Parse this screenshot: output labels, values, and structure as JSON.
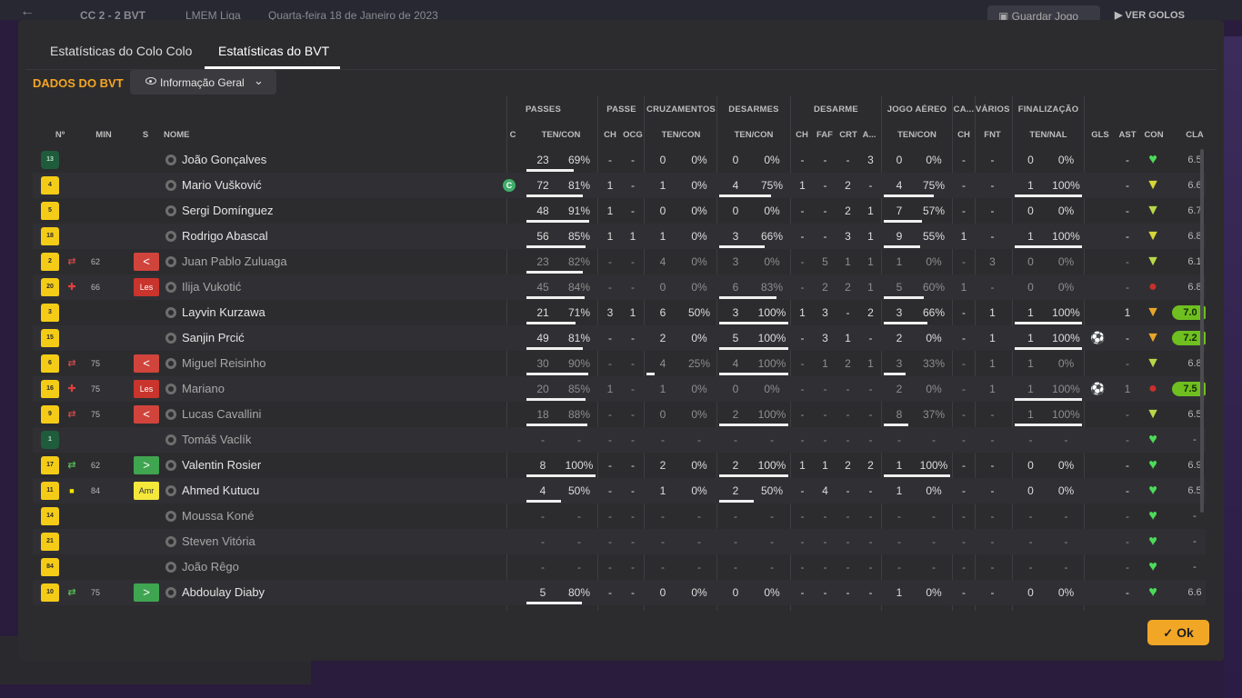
{
  "header": {
    "back_icon": "arrow-left-icon",
    "score": "CC 2 - 2 BVT",
    "competition": "LMEM Liga",
    "date": "Quarta-feira 18 de Janeiro de 2023",
    "save_label": "Guardar Jogo",
    "view_label": "VER GOLOS"
  },
  "tabs": [
    "Estatísticas do Colo Colo",
    "Estatísticas do BVT"
  ],
  "section_title": "DADOS DO BVT",
  "view_select": {
    "label": "Informação Geral",
    "icon": "eye-icon"
  },
  "group_headers": [
    "PASSES",
    "PASSE",
    "CRUZAMENTOS",
    "DESARMES",
    "DESARME",
    "JOGO AÉREO",
    "CA...",
    "VÁRIOS",
    "FINALIZAÇÃO"
  ],
  "columns": [
    "Nº",
    "MIN",
    "S",
    "NOME",
    "C",
    "TEN/CON",
    "CH",
    "OCG",
    "TEN/CON",
    "TEN/CON",
    "CH",
    "FAF",
    "CRT",
    "A...",
    "TEN/CON",
    "CH",
    "FNT",
    "TEN/NAL",
    "GLS",
    "AST",
    "CON",
    "CLA"
  ],
  "colors": {
    "accent": "#f5a623",
    "shirt": "#f4cc17",
    "gk_shirt": "#1f5c3c",
    "rating_high": "#6ebf1f"
  },
  "players": [
    {
      "num": "13",
      "gk": true,
      "name": "João Gonçalves",
      "stats": [
        "23",
        "69%",
        "-",
        "-",
        "0",
        "0%",
        "0",
        "0%",
        "-",
        "-",
        "-",
        "3",
        "0",
        "0%",
        "-",
        "-",
        "0",
        "0%",
        "",
        "-"
      ],
      "con": "green",
      "cla": "6.5",
      "bars": [
        0.69,
        0,
        0,
        0,
        0,
        0
      ]
    },
    {
      "num": "4",
      "name": "Mario Vušković",
      "captain": "C",
      "stats": [
        "72",
        "81%",
        "1",
        "-",
        "1",
        "0%",
        "4",
        "75%",
        "1",
        "-",
        "2",
        "-",
        "4",
        "75%",
        "-",
        "-",
        "1",
        "100%",
        "",
        "-"
      ],
      "con": "yellow",
      "cla": "6.6",
      "bars": [
        0.81,
        0,
        0.75,
        0,
        0.75,
        1
      ]
    },
    {
      "num": "5",
      "name": "Sergi Domínguez",
      "stats": [
        "48",
        "91%",
        "1",
        "-",
        "0",
        "0%",
        "0",
        "0%",
        "-",
        "-",
        "2",
        "1",
        "7",
        "57%",
        "-",
        "-",
        "0",
        "0%",
        "",
        "-"
      ],
      "con": "lime",
      "cla": "6.7",
      "bars": [
        0.91,
        0,
        0,
        0,
        0.57,
        0
      ]
    },
    {
      "num": "18",
      "name": "Rodrigo Abascal",
      "stats": [
        "56",
        "85%",
        "1",
        "1",
        "1",
        "0%",
        "3",
        "66%",
        "-",
        "-",
        "3",
        "1",
        "9",
        "55%",
        "1",
        "-",
        "1",
        "100%",
        "",
        "-"
      ],
      "con": "yellow",
      "cla": "6.8",
      "bars": [
        0.85,
        0,
        0.66,
        0,
        0.55,
        1
      ]
    },
    {
      "num": "2",
      "name": "Juan Pablo Zuluaga",
      "sub": true,
      "event": "sub-out",
      "minute": "62",
      "status": "<",
      "stats": [
        "23",
        "82%",
        "-",
        "-",
        "4",
        "0%",
        "3",
        "0%",
        "-",
        "5",
        "1",
        "1",
        "1",
        "0%",
        "-",
        "3",
        "0",
        "0%",
        "",
        "-"
      ],
      "con": "lime",
      "cla": "6.1",
      "bars": [
        0.82,
        0,
        0,
        0,
        0,
        0
      ]
    },
    {
      "num": "20",
      "name": "Ilija Vukotić",
      "sub": true,
      "event": "injury",
      "minute": "66",
      "status": "Les",
      "stats": [
        "45",
        "84%",
        "-",
        "-",
        "0",
        "0%",
        "6",
        "83%",
        "-",
        "2",
        "2",
        "1",
        "5",
        "60%",
        "1",
        "-",
        "0",
        "0%",
        "",
        "-"
      ],
      "con": "red",
      "cla": "6.8",
      "bars": [
        0.84,
        0,
        0.83,
        0,
        0.6,
        0
      ]
    },
    {
      "num": "3",
      "name": "Layvin Kurzawa",
      "stats": [
        "21",
        "71%",
        "3",
        "1",
        "6",
        "50%",
        "3",
        "100%",
        "1",
        "3",
        "-",
        "2",
        "3",
        "66%",
        "-",
        "1",
        "1",
        "100%",
        "",
        "1"
      ],
      "con": "orange",
      "cla": "7.0",
      "cla_hi": true,
      "bars": [
        0.71,
        0,
        1,
        0,
        0.66,
        1
      ]
    },
    {
      "num": "15",
      "name": "Sanjin Prcić",
      "stats": [
        "49",
        "81%",
        "-",
        "-",
        "2",
        "0%",
        "5",
        "100%",
        "-",
        "3",
        "1",
        "-",
        "2",
        "0%",
        "-",
        "1",
        "1",
        "100%",
        "ball",
        "-"
      ],
      "con": "orange",
      "cla": "7.2",
      "cla_hi": true,
      "bars": [
        0.81,
        0,
        1,
        0,
        0,
        1
      ]
    },
    {
      "num": "6",
      "name": "Miguel Reisinho",
      "sub": true,
      "event": "sub-out",
      "minute": "75",
      "status": "<",
      "stats": [
        "30",
        "90%",
        "-",
        "-",
        "4",
        "25%",
        "4",
        "100%",
        "-",
        "1",
        "2",
        "1",
        "3",
        "33%",
        "-",
        "1",
        "1",
        "0%",
        "",
        "-"
      ],
      "con": "lime",
      "cla": "6.8",
      "bars": [
        0.9,
        0.25,
        1,
        0,
        0.33,
        0
      ]
    },
    {
      "num": "16",
      "name": "Mariano",
      "sub": true,
      "event": "injury",
      "minute": "75",
      "status": "Les",
      "stats": [
        "20",
        "85%",
        "1",
        "-",
        "1",
        "0%",
        "0",
        "0%",
        "-",
        "-",
        "-",
        "-",
        "2",
        "0%",
        "-",
        "1",
        "1",
        "100%",
        "ball",
        "1"
      ],
      "con": "red",
      "cla": "7.5",
      "cla_hi": true,
      "bars": [
        0.85,
        0,
        0,
        0,
        0,
        1
      ]
    },
    {
      "num": "9",
      "name": "Lucas Cavallini",
      "sub": true,
      "event": "sub-out",
      "minute": "75",
      "status": "<",
      "stats": [
        "18",
        "88%",
        "-",
        "-",
        "0",
        "0%",
        "2",
        "100%",
        "-",
        "-",
        "-",
        "-",
        "8",
        "37%",
        "-",
        "-",
        "1",
        "100%",
        "",
        "-"
      ],
      "con": "lime",
      "cla": "6.5",
      "bars": [
        0.88,
        0,
        1,
        0,
        0.37,
        1
      ]
    },
    {
      "num": "1",
      "gk": true,
      "name": "Tomáš Vaclík",
      "sub": true,
      "stats": [
        "-",
        "-",
        "-",
        "-",
        "-",
        "-",
        "-",
        "-",
        "-",
        "-",
        "-",
        "-",
        "-",
        "-",
        "-",
        "-",
        "-",
        "-",
        "",
        "-"
      ],
      "con": "green",
      "cla": "-",
      "bars": [
        0,
        0,
        0,
        0,
        0,
        0
      ]
    },
    {
      "num": "17",
      "name": "Valentin Rosier",
      "event": "sub-in",
      "minute": "62",
      "status": ">",
      "stats": [
        "8",
        "100%",
        "-",
        "-",
        "2",
        "0%",
        "2",
        "100%",
        "1",
        "1",
        "2",
        "2",
        "1",
        "100%",
        "-",
        "-",
        "0",
        "0%",
        "",
        "-"
      ],
      "con": "green",
      "cla": "6.9",
      "bars": [
        1,
        0,
        1,
        0,
        1,
        0
      ]
    },
    {
      "num": "11",
      "name": "Ahmed Kutucu",
      "event": "yellow-card",
      "minute": "84",
      "status": "Amr",
      "stats": [
        "4",
        "50%",
        "-",
        "-",
        "1",
        "0%",
        "2",
        "50%",
        "-",
        "4",
        "-",
        "-",
        "1",
        "0%",
        "-",
        "-",
        "0",
        "0%",
        "",
        "-"
      ],
      "con": "green",
      "cla": "6.5",
      "bars": [
        0.5,
        0,
        0.5,
        0,
        0,
        0
      ]
    },
    {
      "num": "14",
      "name": "Moussa Koné",
      "sub": true,
      "stats": [
        "-",
        "-",
        "-",
        "-",
        "-",
        "-",
        "-",
        "-",
        "-",
        "-",
        "-",
        "-",
        "-",
        "-",
        "-",
        "-",
        "-",
        "-",
        "",
        "-"
      ],
      "con": "green",
      "cla": "-",
      "bars": [
        0,
        0,
        0,
        0,
        0,
        0
      ]
    },
    {
      "num": "21",
      "name": "Steven Vitória",
      "sub": true,
      "stats": [
        "-",
        "-",
        "-",
        "-",
        "-",
        "-",
        "-",
        "-",
        "-",
        "-",
        "-",
        "-",
        "-",
        "-",
        "-",
        "-",
        "-",
        "-",
        "",
        "-"
      ],
      "con": "green",
      "cla": "-",
      "bars": [
        0,
        0,
        0,
        0,
        0,
        0
      ]
    },
    {
      "num": "84",
      "name": "João Rêgo",
      "sub": true,
      "stats": [
        "-",
        "-",
        "-",
        "-",
        "-",
        "-",
        "-",
        "-",
        "-",
        "-",
        "-",
        "-",
        "-",
        "-",
        "-",
        "-",
        "-",
        "-",
        "",
        "-"
      ],
      "con": "green",
      "cla": "-",
      "bars": [
        0,
        0,
        0,
        0,
        0,
        0
      ]
    },
    {
      "num": "10",
      "name": "Abdoulay Diaby",
      "event": "sub-in",
      "minute": "75",
      "status": ">",
      "stats": [
        "5",
        "80%",
        "-",
        "-",
        "0",
        "0%",
        "0",
        "0%",
        "-",
        "-",
        "-",
        "-",
        "1",
        "0%",
        "-",
        "-",
        "0",
        "0%",
        "",
        "-"
      ],
      "con": "green",
      "cla": "6.6",
      "bars": [
        0.8,
        0,
        0,
        0,
        0,
        0
      ]
    }
  ],
  "ok_label": "Ok"
}
